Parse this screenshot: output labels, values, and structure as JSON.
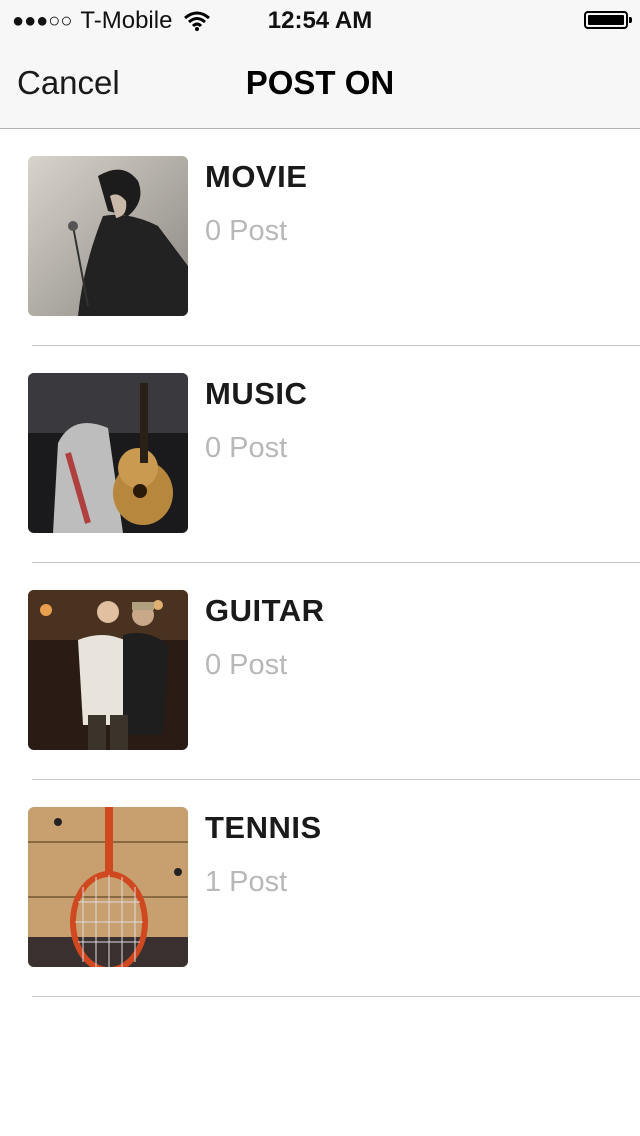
{
  "status_bar": {
    "signal": "●●●○○",
    "carrier": "T-Mobile",
    "time": "12:54 AM"
  },
  "nav": {
    "cancel_label": "Cancel",
    "title": "POST ON"
  },
  "categories": [
    {
      "title": "MOVIE",
      "count": "0 Post"
    },
    {
      "title": "MUSIC",
      "count": "0 Post"
    },
    {
      "title": "GUITAR",
      "count": "0 Post"
    },
    {
      "title": "TENNIS",
      "count": "1 Post"
    }
  ]
}
